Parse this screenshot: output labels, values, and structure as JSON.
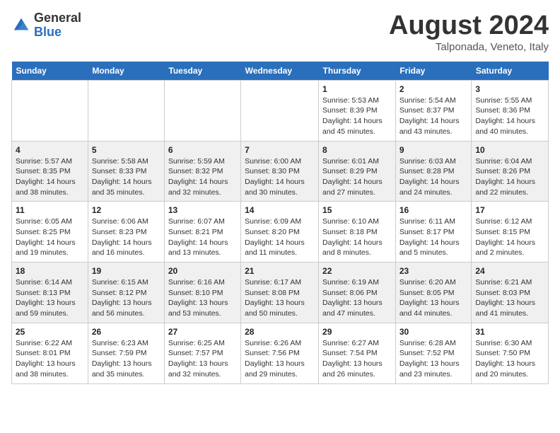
{
  "header": {
    "logo_general": "General",
    "logo_blue": "Blue",
    "title": "August 2024",
    "subtitle": "Talponada, Veneto, Italy"
  },
  "days_of_week": [
    "Sunday",
    "Monday",
    "Tuesday",
    "Wednesday",
    "Thursday",
    "Friday",
    "Saturday"
  ],
  "weeks": [
    [
      {
        "day": "",
        "info": ""
      },
      {
        "day": "",
        "info": ""
      },
      {
        "day": "",
        "info": ""
      },
      {
        "day": "",
        "info": ""
      },
      {
        "day": "1",
        "info": "Sunrise: 5:53 AM\nSunset: 8:39 PM\nDaylight: 14 hours\nand 45 minutes."
      },
      {
        "day": "2",
        "info": "Sunrise: 5:54 AM\nSunset: 8:37 PM\nDaylight: 14 hours\nand 43 minutes."
      },
      {
        "day": "3",
        "info": "Sunrise: 5:55 AM\nSunset: 8:36 PM\nDaylight: 14 hours\nand 40 minutes."
      }
    ],
    [
      {
        "day": "4",
        "info": "Sunrise: 5:57 AM\nSunset: 8:35 PM\nDaylight: 14 hours\nand 38 minutes."
      },
      {
        "day": "5",
        "info": "Sunrise: 5:58 AM\nSunset: 8:33 PM\nDaylight: 14 hours\nand 35 minutes."
      },
      {
        "day": "6",
        "info": "Sunrise: 5:59 AM\nSunset: 8:32 PM\nDaylight: 14 hours\nand 32 minutes."
      },
      {
        "day": "7",
        "info": "Sunrise: 6:00 AM\nSunset: 8:30 PM\nDaylight: 14 hours\nand 30 minutes."
      },
      {
        "day": "8",
        "info": "Sunrise: 6:01 AM\nSunset: 8:29 PM\nDaylight: 14 hours\nand 27 minutes."
      },
      {
        "day": "9",
        "info": "Sunrise: 6:03 AM\nSunset: 8:28 PM\nDaylight: 14 hours\nand 24 minutes."
      },
      {
        "day": "10",
        "info": "Sunrise: 6:04 AM\nSunset: 8:26 PM\nDaylight: 14 hours\nand 22 minutes."
      }
    ],
    [
      {
        "day": "11",
        "info": "Sunrise: 6:05 AM\nSunset: 8:25 PM\nDaylight: 14 hours\nand 19 minutes."
      },
      {
        "day": "12",
        "info": "Sunrise: 6:06 AM\nSunset: 8:23 PM\nDaylight: 14 hours\nand 16 minutes."
      },
      {
        "day": "13",
        "info": "Sunrise: 6:07 AM\nSunset: 8:21 PM\nDaylight: 14 hours\nand 13 minutes."
      },
      {
        "day": "14",
        "info": "Sunrise: 6:09 AM\nSunset: 8:20 PM\nDaylight: 14 hours\nand 11 minutes."
      },
      {
        "day": "15",
        "info": "Sunrise: 6:10 AM\nSunset: 8:18 PM\nDaylight: 14 hours\nand 8 minutes."
      },
      {
        "day": "16",
        "info": "Sunrise: 6:11 AM\nSunset: 8:17 PM\nDaylight: 14 hours\nand 5 minutes."
      },
      {
        "day": "17",
        "info": "Sunrise: 6:12 AM\nSunset: 8:15 PM\nDaylight: 14 hours\nand 2 minutes."
      }
    ],
    [
      {
        "day": "18",
        "info": "Sunrise: 6:14 AM\nSunset: 8:13 PM\nDaylight: 13 hours\nand 59 minutes."
      },
      {
        "day": "19",
        "info": "Sunrise: 6:15 AM\nSunset: 8:12 PM\nDaylight: 13 hours\nand 56 minutes."
      },
      {
        "day": "20",
        "info": "Sunrise: 6:16 AM\nSunset: 8:10 PM\nDaylight: 13 hours\nand 53 minutes."
      },
      {
        "day": "21",
        "info": "Sunrise: 6:17 AM\nSunset: 8:08 PM\nDaylight: 13 hours\nand 50 minutes."
      },
      {
        "day": "22",
        "info": "Sunrise: 6:19 AM\nSunset: 8:06 PM\nDaylight: 13 hours\nand 47 minutes."
      },
      {
        "day": "23",
        "info": "Sunrise: 6:20 AM\nSunset: 8:05 PM\nDaylight: 13 hours\nand 44 minutes."
      },
      {
        "day": "24",
        "info": "Sunrise: 6:21 AM\nSunset: 8:03 PM\nDaylight: 13 hours\nand 41 minutes."
      }
    ],
    [
      {
        "day": "25",
        "info": "Sunrise: 6:22 AM\nSunset: 8:01 PM\nDaylight: 13 hours\nand 38 minutes."
      },
      {
        "day": "26",
        "info": "Sunrise: 6:23 AM\nSunset: 7:59 PM\nDaylight: 13 hours\nand 35 minutes."
      },
      {
        "day": "27",
        "info": "Sunrise: 6:25 AM\nSunset: 7:57 PM\nDaylight: 13 hours\nand 32 minutes."
      },
      {
        "day": "28",
        "info": "Sunrise: 6:26 AM\nSunset: 7:56 PM\nDaylight: 13 hours\nand 29 minutes."
      },
      {
        "day": "29",
        "info": "Sunrise: 6:27 AM\nSunset: 7:54 PM\nDaylight: 13 hours\nand 26 minutes."
      },
      {
        "day": "30",
        "info": "Sunrise: 6:28 AM\nSunset: 7:52 PM\nDaylight: 13 hours\nand 23 minutes."
      },
      {
        "day": "31",
        "info": "Sunrise: 6:30 AM\nSunset: 7:50 PM\nDaylight: 13 hours\nand 20 minutes."
      }
    ]
  ]
}
